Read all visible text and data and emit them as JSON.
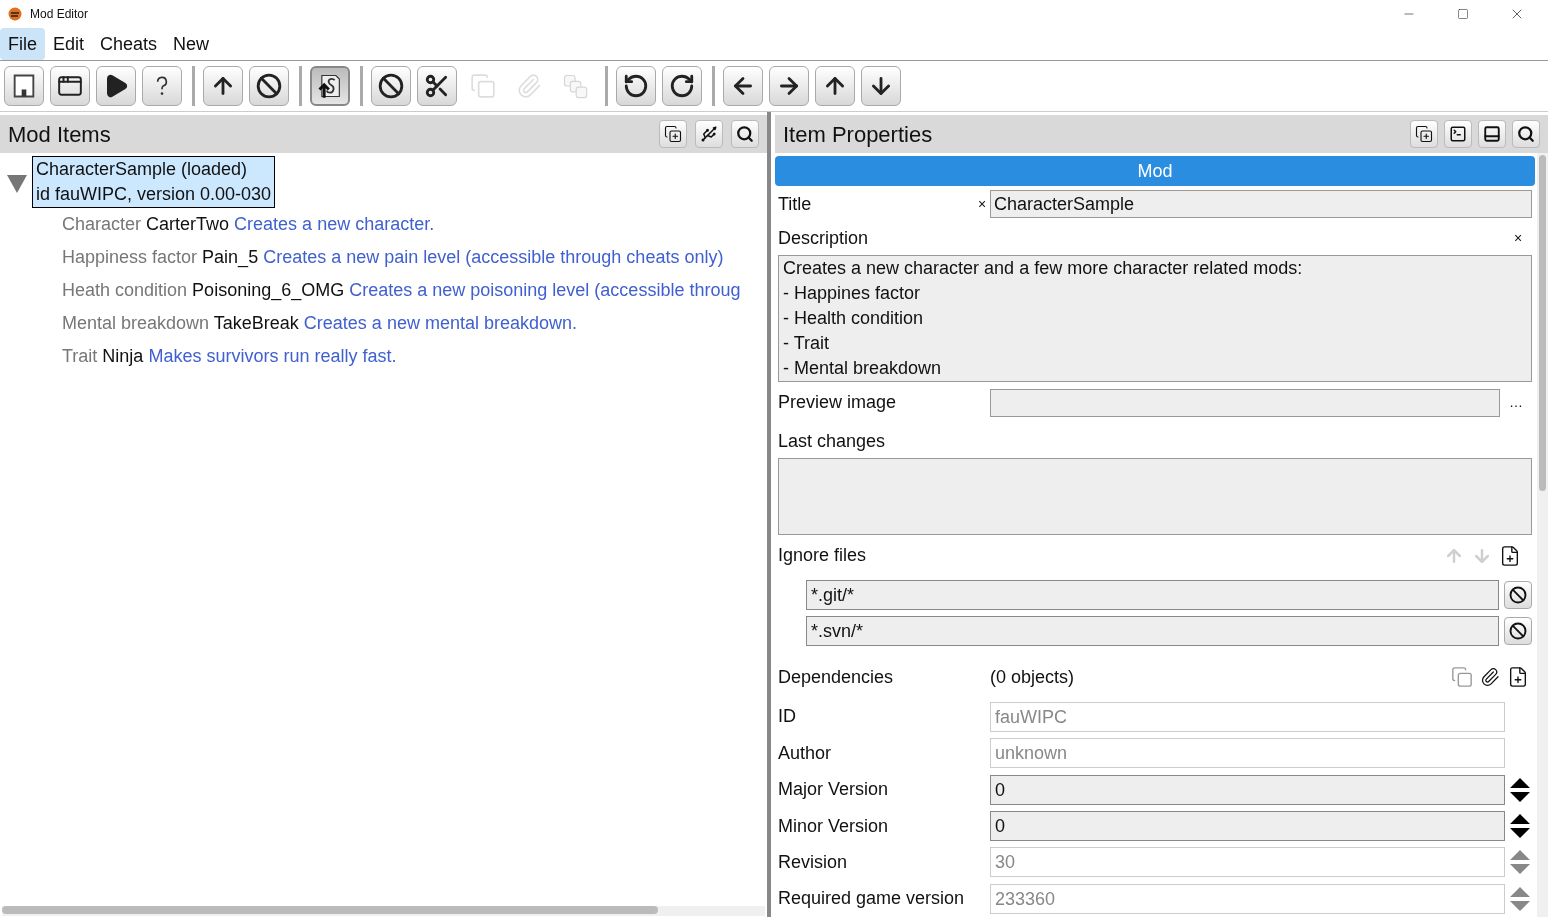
{
  "window": {
    "title": "Mod Editor"
  },
  "menu": [
    {
      "label": "File",
      "selected": true
    },
    {
      "label": "Edit",
      "selected": false
    },
    {
      "label": "Cheats",
      "selected": false
    },
    {
      "label": "New",
      "selected": false
    }
  ],
  "toolbar": [
    [
      {
        "kind": "save",
        "disabled": false,
        "pressed": false
      },
      {
        "kind": "window",
        "disabled": false,
        "pressed": false
      },
      {
        "kind": "play",
        "disabled": false,
        "pressed": false
      },
      {
        "kind": "help",
        "disabled": false,
        "pressed": false
      }
    ],
    [
      {
        "kind": "up",
        "disabled": false,
        "pressed": false
      },
      {
        "kind": "cancel",
        "disabled": false,
        "pressed": false
      }
    ],
    [
      {
        "kind": "source",
        "disabled": false,
        "pressed": true
      }
    ],
    [
      {
        "kind": "cancel",
        "disabled": false,
        "pressed": false
      },
      {
        "kind": "cut",
        "disabled": false,
        "pressed": false
      },
      {
        "kind": "copy",
        "disabled": true,
        "pressed": false
      },
      {
        "kind": "attach",
        "disabled": true,
        "pressed": false
      },
      {
        "kind": "stack",
        "disabled": true,
        "pressed": false
      }
    ],
    [
      {
        "kind": "undo",
        "disabled": false,
        "pressed": false
      },
      {
        "kind": "redo",
        "disabled": false,
        "pressed": false
      }
    ],
    [
      {
        "kind": "left",
        "disabled": false,
        "pressed": false
      },
      {
        "kind": "right",
        "disabled": false,
        "pressed": false
      },
      {
        "kind": "up",
        "disabled": false,
        "pressed": false
      },
      {
        "kind": "down",
        "disabled": false,
        "pressed": false
      }
    ]
  ],
  "mod_items": {
    "title": "Mod Items",
    "tree": [
      {
        "lines": [
          "CharacterSample (loaded)",
          "id fauWIPC, version 0.00-030"
        ],
        "expanded": true,
        "selected": true,
        "children": [
          {
            "type": "Character",
            "name": "CarterTwo",
            "description": "Creates a new character."
          },
          {
            "type": "Happiness factor",
            "name": "Pain_5",
            "description": "Creates a new pain level (accessible through cheats only)"
          },
          {
            "type": "Heath condition",
            "name": "Poisoning_6_OMG",
            "description": "Creates a new poisoning level (accessible throug"
          },
          {
            "type": "Mental breakdown",
            "name": "TakeBreak",
            "description": "Creates a new mental breakdown."
          },
          {
            "type": "Trait",
            "name": "Ninja",
            "description": "Makes survivors run really fast."
          }
        ]
      }
    ]
  },
  "item_properties": {
    "title": "Item Properties",
    "section": "Mod",
    "title_field": {
      "label": "Title",
      "clear": "×",
      "value": "CharacterSample"
    },
    "description": {
      "label": "Description",
      "clear": "×",
      "lines": [
        "Creates a new character and a few more character related mods:",
        "- Happines factor",
        "- Health condition",
        "- Trait",
        "- Mental breakdown"
      ]
    },
    "preview_image": {
      "label": "Preview image",
      "browse": "…"
    },
    "last_changes": {
      "label": "Last changes"
    },
    "ignore_files": {
      "label": "Ignore files",
      "items": [
        "*.git/*",
        "*.svn/*"
      ]
    },
    "dependencies": {
      "label": "Dependencies",
      "value": "(0 objects)"
    },
    "fields": [
      {
        "label": "ID",
        "value": "fauWIPC",
        "disabled": true,
        "kind": "text"
      },
      {
        "label": "Author",
        "value": "unknown",
        "disabled": true,
        "kind": "text"
      },
      {
        "label": "Major Version",
        "value": "0",
        "disabled": false,
        "kind": "spin"
      },
      {
        "label": "Minor Version",
        "value": "0",
        "disabled": false,
        "kind": "spin"
      },
      {
        "label": "Revision",
        "value": "30",
        "disabled": true,
        "kind": "spin"
      },
      {
        "label": "Required game version",
        "value": "233360",
        "disabled": true,
        "kind": "spin"
      }
    ]
  }
}
